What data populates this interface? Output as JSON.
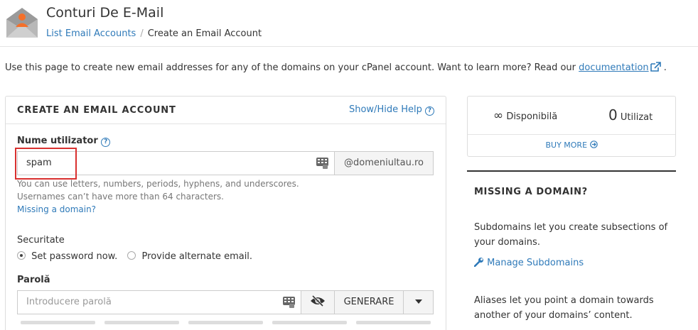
{
  "header": {
    "title": "Conturi De E-Mail",
    "breadcrumb": {
      "parent": "List Email Accounts",
      "separator": "/",
      "current": "Create an Email Account"
    }
  },
  "intro": {
    "text": "Use this page to create new email addresses for any of the domains on your cPanel account. Want to learn more? Read our",
    "link": "documentation",
    "end": "."
  },
  "form": {
    "title": "CREATE AN EMAIL ACCOUNT",
    "help_toggle": "Show/Hide Help",
    "username": {
      "label": "Nume utilizator",
      "value": "spam",
      "domain": "@domeniultau.ro",
      "hint_1": "You can use letters, numbers, periods, hyphens, and underscores.",
      "hint_2": "Usernames can’t have more than 64 characters.",
      "missing_link": "Missing a domain?"
    },
    "security": {
      "label": "Securitate",
      "option_set": "Set password now.",
      "option_alt": "Provide alternate email.",
      "selected": "Set password now."
    },
    "password": {
      "label": "Parolă",
      "placeholder": "Introducere parolă",
      "generate": "GENERARE"
    }
  },
  "stats": {
    "available_symbol": "∞",
    "available_label": "Disponibilă",
    "used_count": "0",
    "used_label": "Utilizat",
    "buy_more": "BUY MORE"
  },
  "sidebar": {
    "title": "MISSING A DOMAIN?",
    "subdomains_text": "Subdomains let you create subsections of your domains.",
    "subdomains_link": "Manage Subdomains",
    "aliases_text": "Aliases let you point a domain towards another of your domains’ content."
  },
  "colors": {
    "link": "#2f7ab9",
    "highlight": "#d9302f",
    "logo": "#f4702a"
  }
}
